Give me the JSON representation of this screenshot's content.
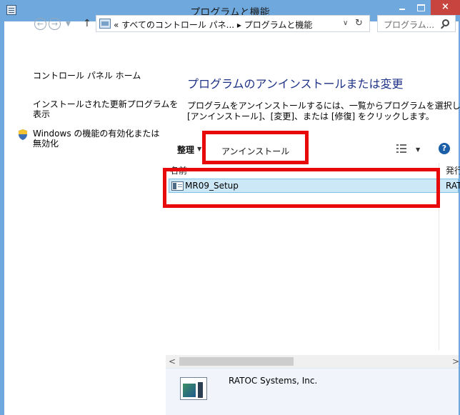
{
  "window": {
    "title": "プログラムと機能",
    "controls": {
      "minimize": "–",
      "maximize": "□",
      "close": "×"
    }
  },
  "navigation": {
    "back": "←",
    "forward": "→",
    "recent_dropdown": "▼",
    "up": "↑",
    "address_path": "« すべてのコントロール パネ... ▸ プログラムと機能",
    "address_dropdown": "∨",
    "refresh": "↻",
    "search_placeholder": "プログラム..."
  },
  "left_pane": {
    "home_link": "コントロール パネル ホーム",
    "updates_link_line1": "インストールされた更新プログラムを",
    "updates_link_line2": "表示",
    "features_link_line1": "Windows の機能の有効化または",
    "features_link_line2": "無効化"
  },
  "main": {
    "heading": "プログラムのアンインストールまたは変更",
    "description_line1": "プログラムをアンインストールするには、一覧からプログラムを選択して",
    "description_line2": "[アンインストール]、[変更]、または [修復] をクリックします。"
  },
  "toolbar": {
    "organize": "整理",
    "organize_dropdown": "▼",
    "uninstall": "アンインストール",
    "view_dropdown": "▼",
    "help": "?"
  },
  "list": {
    "columns": [
      "名前",
      "発行"
    ],
    "rows": [
      {
        "name": "MR09_Setup",
        "publisher": "RAT"
      }
    ]
  },
  "scrollbar": {
    "left": "<",
    "right": ">"
  },
  "details": {
    "publisher": "RATOC Systems, Inc."
  },
  "colors": {
    "title_bar": "#6fa8dc",
    "close_button": "#c7453e",
    "highlight_red": "#e80a0a",
    "selected_row": "#cce8f6",
    "heading_blue": "#1e3287"
  },
  "icons": [
    "control-panel-icon",
    "search-icon",
    "shield-icon",
    "view-options-icon",
    "help-icon",
    "program-icon"
  ]
}
